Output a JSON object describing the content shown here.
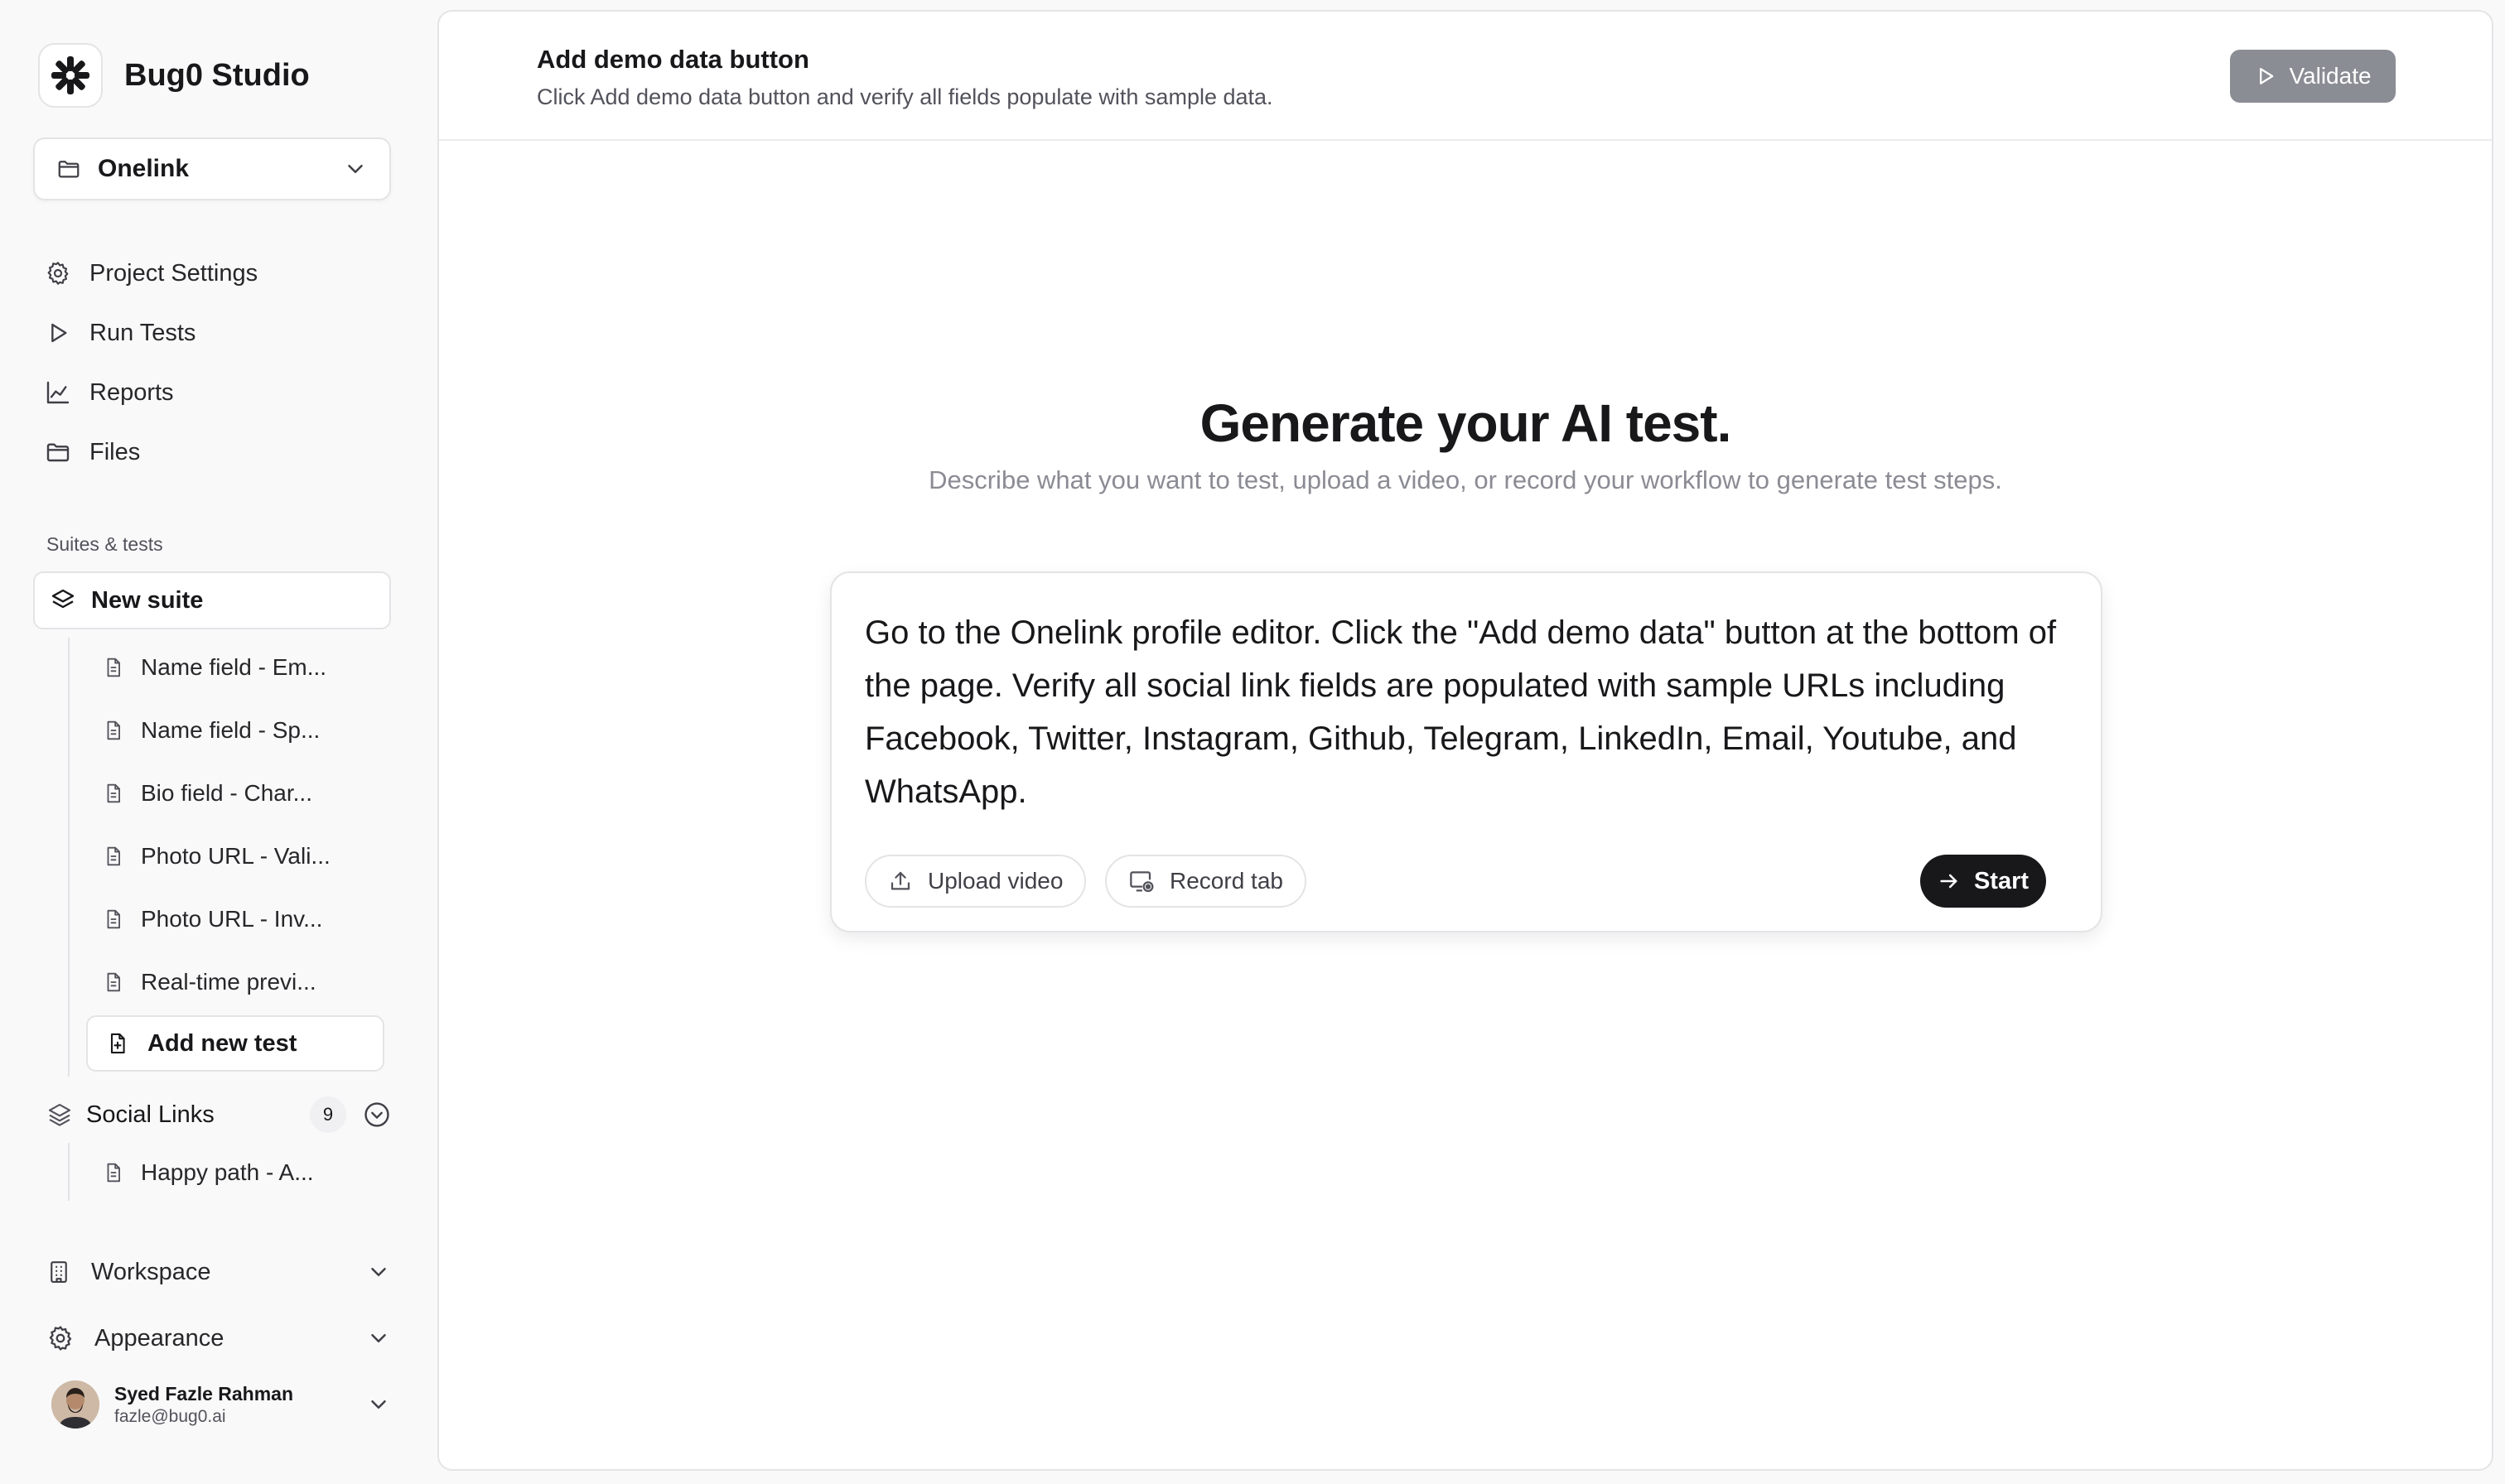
{
  "brand": {
    "name": "Bug0 Studio",
    "logo_icon": "snowflake-logo-icon"
  },
  "project": {
    "name": "Onelink"
  },
  "nav": {
    "project_settings": "Project Settings",
    "run_tests": "Run Tests",
    "reports": "Reports",
    "files": "Files"
  },
  "suites": {
    "section_label": "Suites & tests",
    "new_suite": "New suite",
    "tests": [
      "Name field - Em...",
      "Name field - Sp...",
      "Bio field - Char...",
      "Photo URL - Vali...",
      "Photo URL - Inv...",
      "Real-time previ..."
    ],
    "add_new_test": "Add new test",
    "social_links": {
      "name": "Social Links",
      "count": "9",
      "tests": [
        "Happy path - A..."
      ]
    }
  },
  "footer": {
    "workspace": "Workspace",
    "appearance": "Appearance"
  },
  "user": {
    "name": "Syed Fazle Rahman",
    "email": "fazle@bug0.ai"
  },
  "header": {
    "title": "Add demo data button",
    "subtitle": "Click Add demo data button and verify all fields populate with sample data.",
    "validate": "Validate"
  },
  "hero": {
    "title": "Generate your AI test.",
    "subtitle": "Describe what you want to test, upload a video, or record your workflow to generate test steps."
  },
  "prompt": {
    "text": "Go to the Onelink profile editor. Click the \"Add demo data\" button at the bottom of the page. Verify all social link fields are populated with sample URLs including Facebook, Twitter, Instagram, Github, Telegram, LinkedIn, Email, Youtube, and WhatsApp.",
    "upload_video": "Upload video",
    "record_tab": "Record tab",
    "start": "Start"
  },
  "colors": {
    "accent_dark": "#18181b",
    "validate_disabled": "#8a8d94",
    "muted_text": "#8b8b94"
  }
}
